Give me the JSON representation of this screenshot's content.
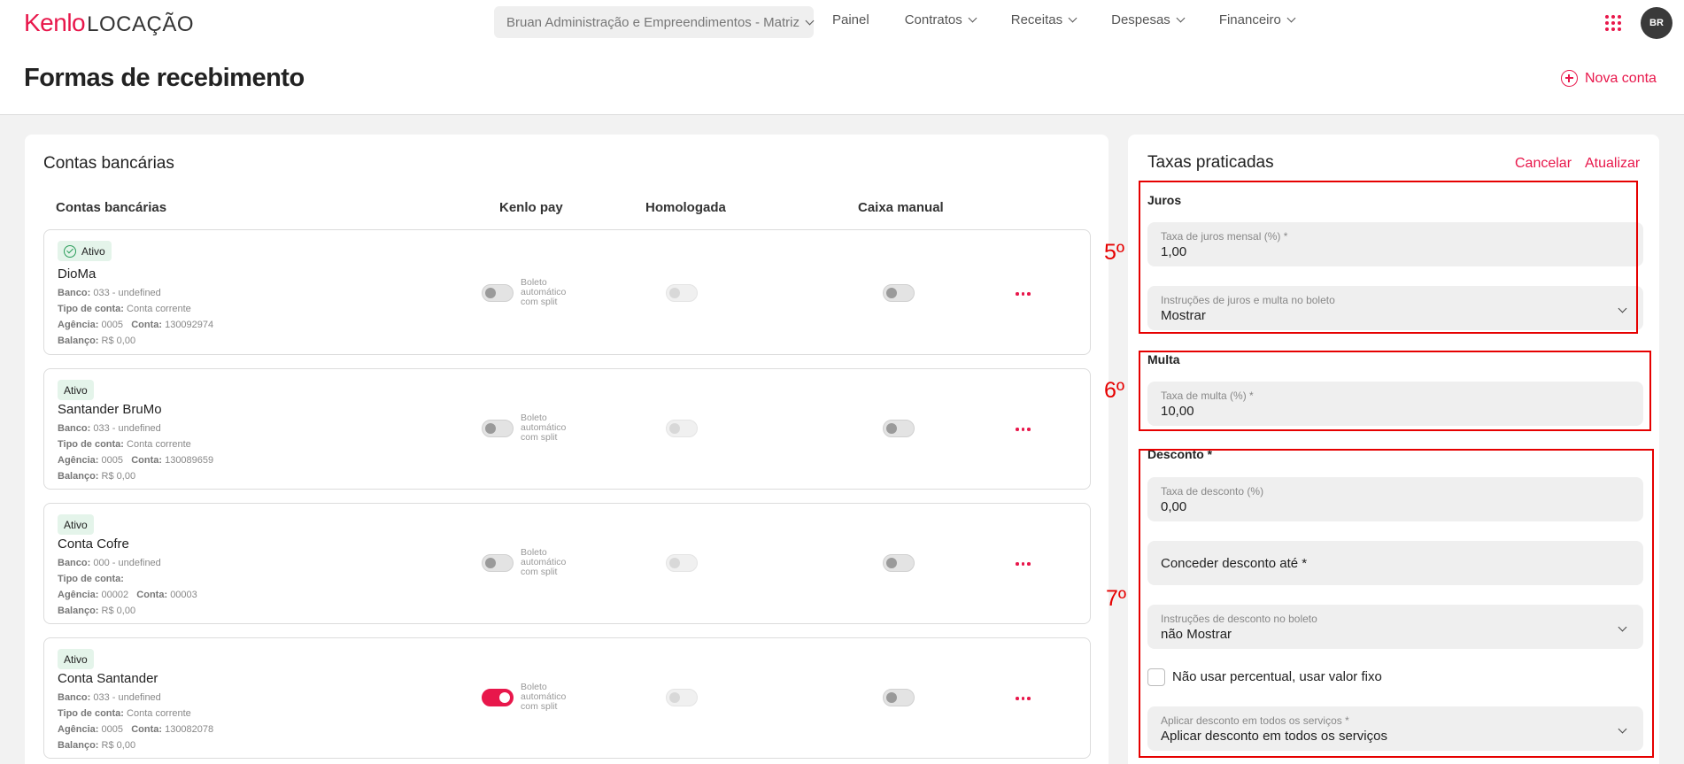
{
  "header": {
    "logo_brand": "Kenlo",
    "logo_suffix": "LOCAÇÃO",
    "company_selector": "Bruan Administração e Empreendimentos - Matriz",
    "nav": [
      "Painel",
      "Contratos",
      "Receitas",
      "Despesas",
      "Financeiro"
    ],
    "avatar_initials": "BR",
    "page_title": "Formas de recebimento",
    "new_account": "Nova conta"
  },
  "accounts_panel": {
    "title": "Contas bancárias",
    "columns": [
      "Contas bancárias",
      "Kenlo pay",
      "Homologada",
      "Caixa manual"
    ],
    "toggle_label": "Boleto automático com split",
    "cards": [
      {
        "status": "Ativo",
        "status_icon": "check-circle-icon",
        "name": "DioMa",
        "banco_label": "Banco:",
        "banco": "033 - undefined",
        "tipo_label": "Tipo de conta:",
        "tipo": "Conta corrente",
        "agencia_label": "Agência:",
        "agencia": "0005",
        "conta_label": "Conta:",
        "conta": "130092974",
        "balanco_label": "Balanço:",
        "balanco": "R$ 0,00",
        "kenlo_pay": false
      },
      {
        "status": "Ativo",
        "status_icon": "",
        "name": "Santander BruMo",
        "banco_label": "Banco:",
        "banco": "033 - undefined",
        "tipo_label": "Tipo de conta:",
        "tipo": "Conta corrente",
        "agencia_label": "Agência:",
        "agencia": "0005",
        "conta_label": "Conta:",
        "conta": "130089659",
        "balanco_label": "Balanço:",
        "balanco": "R$ 0,00",
        "kenlo_pay": false
      },
      {
        "status": "Ativo",
        "status_icon": "",
        "name": "Conta Cofre",
        "banco_label": "Banco:",
        "banco": "000 - undefined",
        "tipo_label": "Tipo de conta:",
        "tipo": "",
        "agencia_label": "Agência:",
        "agencia": "00002",
        "conta_label": "Conta:",
        "conta": "00003",
        "balanco_label": "Balanço:",
        "balanco": "R$ 0,00",
        "kenlo_pay": false
      },
      {
        "status": "Ativo",
        "status_icon": "",
        "name": "Conta Santander",
        "banco_label": "Banco:",
        "banco": "033 - undefined",
        "tipo_label": "Tipo de conta:",
        "tipo": "Conta corrente",
        "agencia_label": "Agência:",
        "agencia": "0005",
        "conta_label": "Conta:",
        "conta": "130082078",
        "balanco_label": "Balanço:",
        "balanco": "R$ 0,00",
        "kenlo_pay": true
      }
    ]
  },
  "rates_panel": {
    "title": "Taxas praticadas",
    "cancel": "Cancelar",
    "update": "Atualizar",
    "juros": {
      "title": "Juros",
      "rate_label": "Taxa de juros mensal (%) *",
      "rate_value": "1,00",
      "instr_label": "Instruções de juros e multa no boleto",
      "instr_value": "Mostrar"
    },
    "multa": {
      "title": "Multa",
      "rate_label": "Taxa de multa (%) *",
      "rate_value": "10,00"
    },
    "desconto": {
      "title": "Desconto *",
      "rate_label": "Taxa de desconto (%)",
      "rate_value": "0,00",
      "until_placeholder": "Conceder desconto até *",
      "instr_label": "Instruções de desconto no boleto",
      "instr_value": "não Mostrar",
      "fixed_checkbox_label": "Não usar percentual, usar valor fixo",
      "fixed_checked": false,
      "apply_label": "Aplicar desconto em todos os serviços *",
      "apply_value": "Aplicar desconto em todos os serviços"
    }
  },
  "annotations": {
    "step5": "5º",
    "step6": "6º",
    "step7": "7º",
    "color": "#e60000"
  },
  "colors": {
    "accent": "#e8174b",
    "badge_bg": "#e4f4ea"
  }
}
